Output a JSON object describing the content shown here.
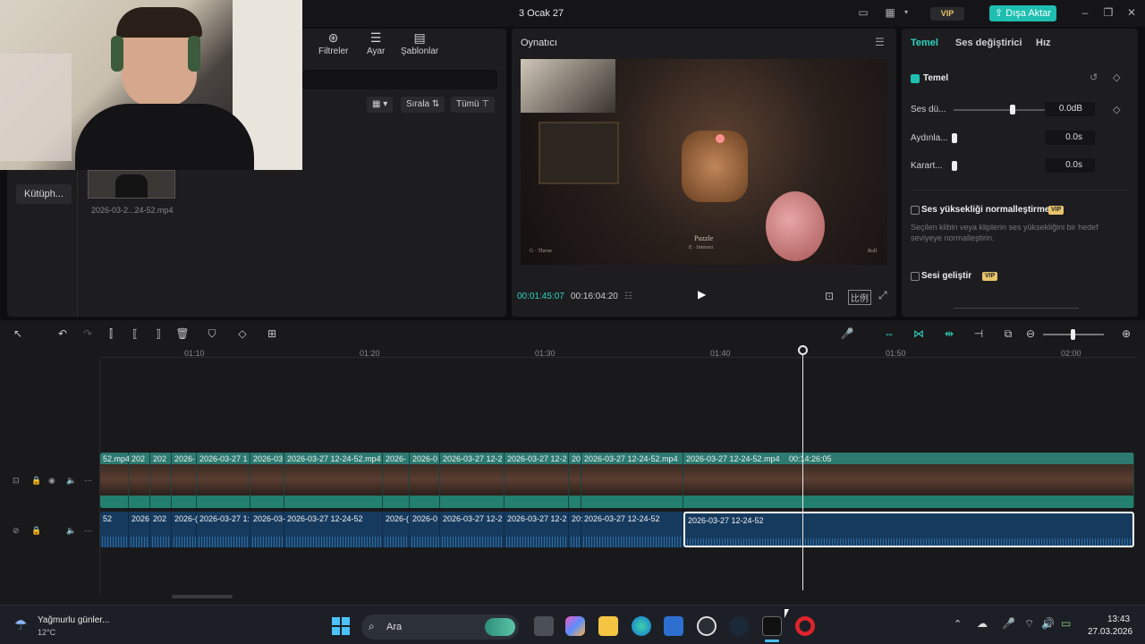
{
  "header": {
    "title": "3 Ocak 27",
    "vip": "VIP",
    "export_label": "Dışa Aktar"
  },
  "media": {
    "tools": [
      {
        "label": "Filtreler",
        "icon": "filters-icon"
      },
      {
        "label": "Ayar",
        "icon": "adjust-icon"
      },
      {
        "label": "Şablonlar",
        "icon": "templates-icon"
      }
    ],
    "sort_label": "Sırala",
    "filter_label": "Tümü",
    "library_label": "Kütüph...",
    "file_name": "2026-03-2...24-52.mp4"
  },
  "player": {
    "title": "Oynatıcı",
    "current_time": "00:01:45:07",
    "total_time": "00:16:04:20",
    "scene_text": "Puzzle",
    "scene_sub": "E · Interact",
    "scene_left": "G · Throw",
    "scene_right": "Roll"
  },
  "properties": {
    "tabs": [
      "Temel",
      "Ses değiştirici",
      "Hız"
    ],
    "section_title": "Temel",
    "volume_label": "Ses dü...",
    "volume_value": "0.0dB",
    "fade_in_label": "Aydınla...",
    "fade_in_value": "0.0s",
    "fade_out_label": "Karart...",
    "fade_out_value": "0.0s",
    "normalize_label": "Ses yüksekliği normalleştirme",
    "normalize_vip": "VIP",
    "normalize_desc": "Seçilen klibin veya kliplerin ses yüksekliğini bir hedef seviyeye normalleştirin.",
    "enhance_label": "Sesi geliştir",
    "enhance_vip": "VIP"
  },
  "timeline": {
    "ticks": [
      "01:10",
      "01:20",
      "01:30",
      "01:40",
      "01:50",
      "02:00"
    ],
    "video_clips": [
      "52.mp4",
      "202",
      "202",
      "2026-",
      "2026-03-27 1",
      "2026-03",
      "2026-03-27 12-24-52.mp4",
      "2026-",
      "2026-0",
      "2026-03-27 12-2",
      "2026-03-27 12-2",
      "20",
      "2026-03-27 12-24-52.mp4",
      "2026-03-27 12-24-52.mp4",
      "00:14:26:05"
    ],
    "audio_clips": [
      "52",
      "2026",
      "202",
      "2026-(",
      "2026-03-27 1:",
      "2026-03-",
      "2026-03-27 12-24-52",
      "2026-(",
      "2026-0",
      "2026-03-27 12-2",
      "2026-03-27 12-2",
      "20:",
      "2026-03-27 12-24-52",
      "2026-03-27 12-24-52"
    ]
  },
  "taskbar": {
    "weather_text": "Yağmurlu günler...",
    "weather_temp": "12°C",
    "search_placeholder": "Ara",
    "time": "13:43",
    "date": "27.03.2026"
  },
  "colors": {
    "accent": "#1ebfb0",
    "vip": "#e7c36a",
    "audio": "#163a5e",
    "video": "#2b6b63"
  }
}
